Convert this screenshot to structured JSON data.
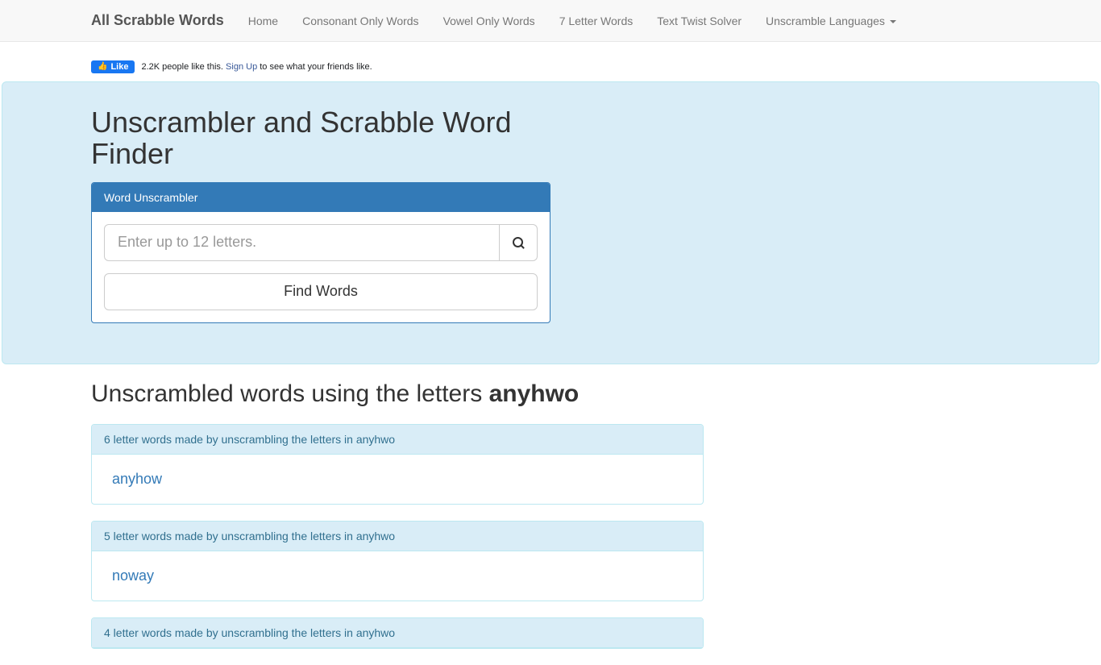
{
  "navbar": {
    "brand": "All Scrabble Words",
    "items": [
      {
        "label": "Home"
      },
      {
        "label": "Consonant Only Words"
      },
      {
        "label": "Vowel Only Words"
      },
      {
        "label": "7 Letter Words"
      },
      {
        "label": "Text Twist Solver"
      },
      {
        "label": "Unscramble Languages",
        "dropdown": true
      }
    ]
  },
  "fb": {
    "like_button": "Like",
    "text_prefix": "2.2K people like this. ",
    "signup": "Sign Up",
    "text_suffix": " to see what your friends like."
  },
  "jumbotron": {
    "title": "Unscrambler and Scrabble Word Finder",
    "panel_heading": "Word Unscrambler",
    "input_placeholder": "Enter up to 12 letters.",
    "find_button": "Find Words"
  },
  "results": {
    "heading_prefix": "Unscrambled words using the letters ",
    "heading_letters": "anyhwo",
    "groups": [
      {
        "heading": "6 letter words made by unscrambling the letters in anyhwo",
        "words": [
          "anyhow"
        ]
      },
      {
        "heading": "5 letter words made by unscrambling the letters in anyhwo",
        "words": [
          "noway"
        ]
      },
      {
        "heading": "4 letter words made by unscrambling the letters in anyhwo",
        "words": []
      }
    ]
  }
}
